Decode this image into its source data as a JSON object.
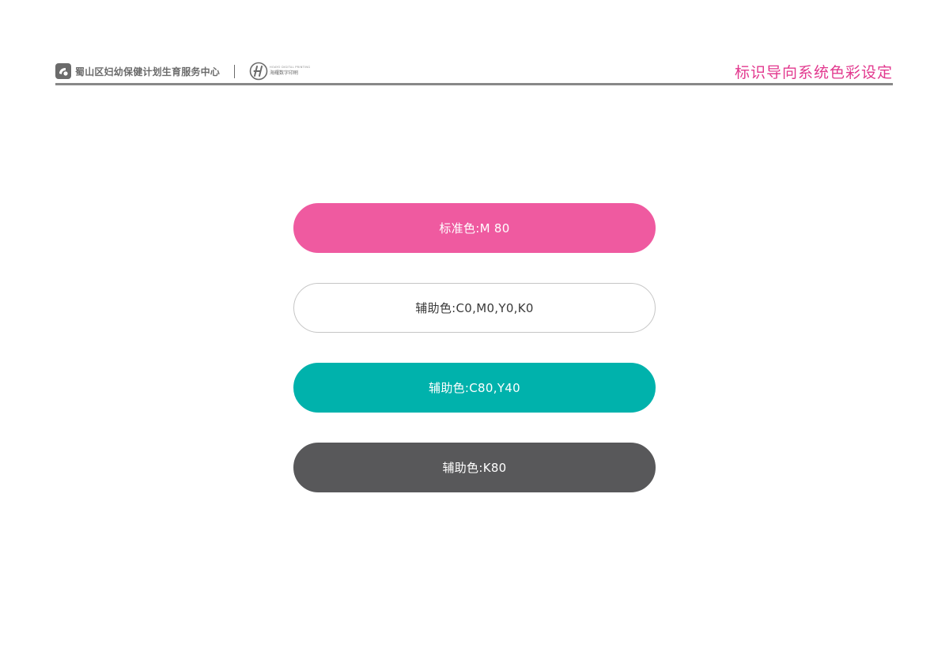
{
  "header": {
    "organization": "蜀山区妇幼保健计划生育服务中心",
    "partner_logo_en": "HOAYO DIGITAL PRINTING",
    "partner_logo_cn": "海耀数字印刷",
    "page_title": "标识导向系统色彩设定"
  },
  "swatches": [
    {
      "label": "标准色:M 80",
      "color": "#ef5aa0",
      "text_color": "#ffffff",
      "border": "#ef5aa0"
    },
    {
      "label": "辅助色:C0,M0,Y0,K0",
      "color": "#ffffff",
      "text_color": "#3a3a3a",
      "border": "#c6c6c6"
    },
    {
      "label": "辅助色:C80,Y40",
      "color": "#00b2ac",
      "text_color": "#ffffff",
      "border": "#00b2ac"
    },
    {
      "label": "辅助色:K80",
      "color": "#58585a",
      "text_color": "#ffffff",
      "border": "#58585a"
    }
  ],
  "colors": {
    "accent": "#e2388e",
    "rule": "#888888"
  },
  "icons": {
    "org_logo": "organization-logo-icon",
    "partner_logo": "partner-logo-icon"
  }
}
